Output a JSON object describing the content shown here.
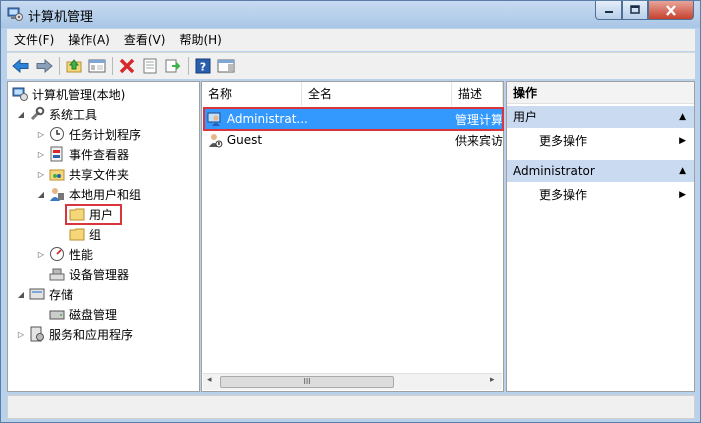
{
  "window": {
    "title": "计算机管理"
  },
  "menu": [
    "文件(F)",
    "操作(A)",
    "查看(V)",
    "帮助(H)"
  ],
  "toolbar": [
    "back-icon",
    "forward-icon",
    "up-folder-icon",
    "show-hide-tree-icon",
    "delete-icon",
    "properties-icon",
    "export-icon",
    "help-icon",
    "action-pane-icon"
  ],
  "tree": {
    "root": "计算机管理(本地)",
    "system_tools": "系统工具",
    "task_scheduler": "任务计划程序",
    "event_viewer": "事件查看器",
    "shared_folders": "共享文件夹",
    "local_users": "本地用户和组",
    "users": "用户",
    "groups": "组",
    "performance": "性能",
    "device_manager": "设备管理器",
    "storage": "存储",
    "disk_management": "磁盘管理",
    "services_apps": "服务和应用程序"
  },
  "list": {
    "columns": [
      "名称",
      "全名",
      "描述"
    ],
    "rows": [
      {
        "name": "Administrat...",
        "fullname": "",
        "desc": "管理计算"
      },
      {
        "name": "Guest",
        "fullname": "",
        "desc": "供来宾访"
      }
    ],
    "scroll_grip": "III"
  },
  "actions": {
    "header": "操作",
    "section1": "用户",
    "more1": "更多操作",
    "section2": "Administrator",
    "more2": "更多操作"
  },
  "colors": {
    "selection": "#3399ff",
    "highlight_box": "#d9353c",
    "action_header": "#c9daf1"
  }
}
